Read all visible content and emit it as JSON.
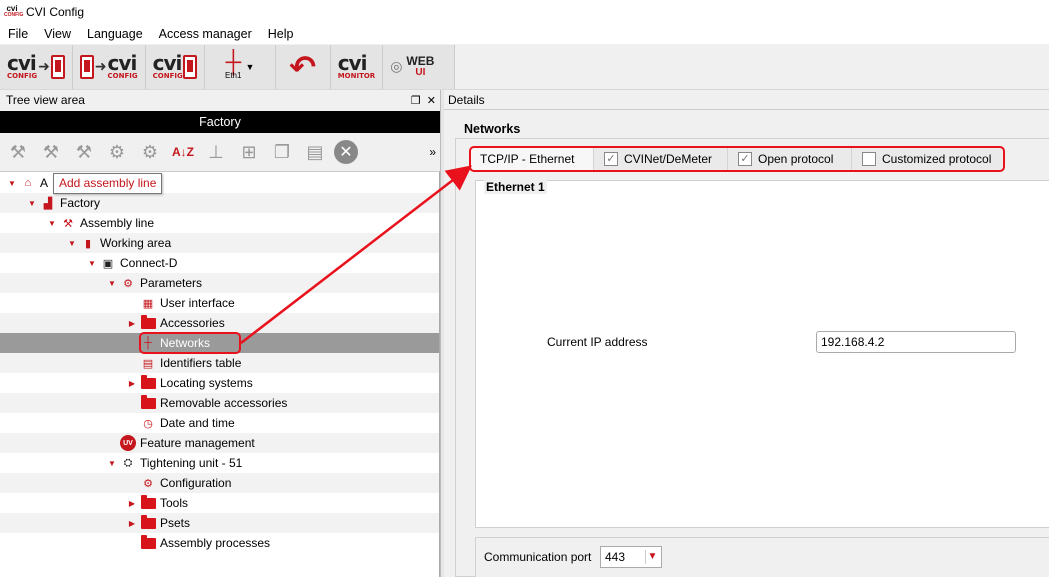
{
  "window": {
    "title": "CVI Config",
    "logo_text": "cvi",
    "logo_sub": "CONFIG"
  },
  "menu": [
    "File",
    "View",
    "Language",
    "Access manager",
    "Help"
  ],
  "toolbar": {
    "cvi_text": "cvi",
    "config_label": "CONFIG",
    "monitor_label": "MONITOR",
    "eth_label": "Eth1",
    "web_label": "WEB",
    "ui_label": "UI"
  },
  "left_pane": {
    "header": "Tree view area",
    "factory_bar": "Factory",
    "tooltip": "Add assembly line"
  },
  "tree": [
    {
      "label": "A",
      "level": 0,
      "icon": "home-icon",
      "expanded": true
    },
    {
      "label": "Factory",
      "level": 1,
      "icon": "factory-icon",
      "expanded": true
    },
    {
      "label": "Assembly line",
      "level": 2,
      "icon": "assembly-line-icon",
      "expanded": true
    },
    {
      "label": "Working area",
      "level": 3,
      "icon": "working-area-icon",
      "expanded": true
    },
    {
      "label": "Connect-D",
      "level": 4,
      "icon": "controller-icon",
      "expanded": true
    },
    {
      "label": "Parameters",
      "level": 5,
      "icon": "parameters-icon",
      "expanded": true
    },
    {
      "label": "User interface",
      "level": 6,
      "icon": "user-interface-icon"
    },
    {
      "label": "Accessories",
      "level": 6,
      "icon": "folder-icon",
      "collapsed": true
    },
    {
      "label": "Networks",
      "level": 6,
      "icon": "networks-icon",
      "selected": true
    },
    {
      "label": "Identifiers table",
      "level": 6,
      "icon": "identifiers-icon"
    },
    {
      "label": "Locating systems",
      "level": 6,
      "icon": "folder-icon",
      "collapsed": true
    },
    {
      "label": "Removable accessories",
      "level": 6,
      "icon": "folder-icon"
    },
    {
      "label": "Date and time",
      "level": 6,
      "icon": "clock-icon"
    },
    {
      "label": "Feature management",
      "level": 5,
      "icon": "uv-icon"
    },
    {
      "label": "Tightening unit - 51",
      "level": 5,
      "icon": "tightening-unit-icon",
      "expanded": true
    },
    {
      "label": "Configuration",
      "level": 6,
      "icon": "configuration-icon"
    },
    {
      "label": "Tools",
      "level": 6,
      "icon": "folder-icon",
      "collapsed": true
    },
    {
      "label": "Psets",
      "level": 6,
      "icon": "folder-icon",
      "collapsed": true
    },
    {
      "label": "Assembly processes",
      "level": 6,
      "icon": "folder-icon"
    }
  ],
  "right_pane": {
    "header": "Details",
    "section_title": "Networks",
    "tabs": [
      {
        "label": "TCP/IP - Ethernet",
        "checkbox": false,
        "active": true
      },
      {
        "label": "CVINet/DeMeter",
        "checkbox": true,
        "checked": true
      },
      {
        "label": "Open protocol",
        "checkbox": true,
        "checked": true
      },
      {
        "label": "Customized protocol",
        "checkbox": true,
        "checked": false
      }
    ],
    "ethernet_group": "Ethernet 1",
    "ip_label": "Current IP address",
    "ip_value": "192.168.4.2",
    "port_label": "Communication port",
    "port_value": "443"
  },
  "colors": {
    "accent": "#c4161c",
    "highlight": "#e8111c",
    "selected_row": "#9a9a9a"
  },
  "glyphs": {
    "check": "✓",
    "caret_down": "▼",
    "caret_right": "▶",
    "more": "»",
    "close": "✕",
    "restore": "❐"
  }
}
